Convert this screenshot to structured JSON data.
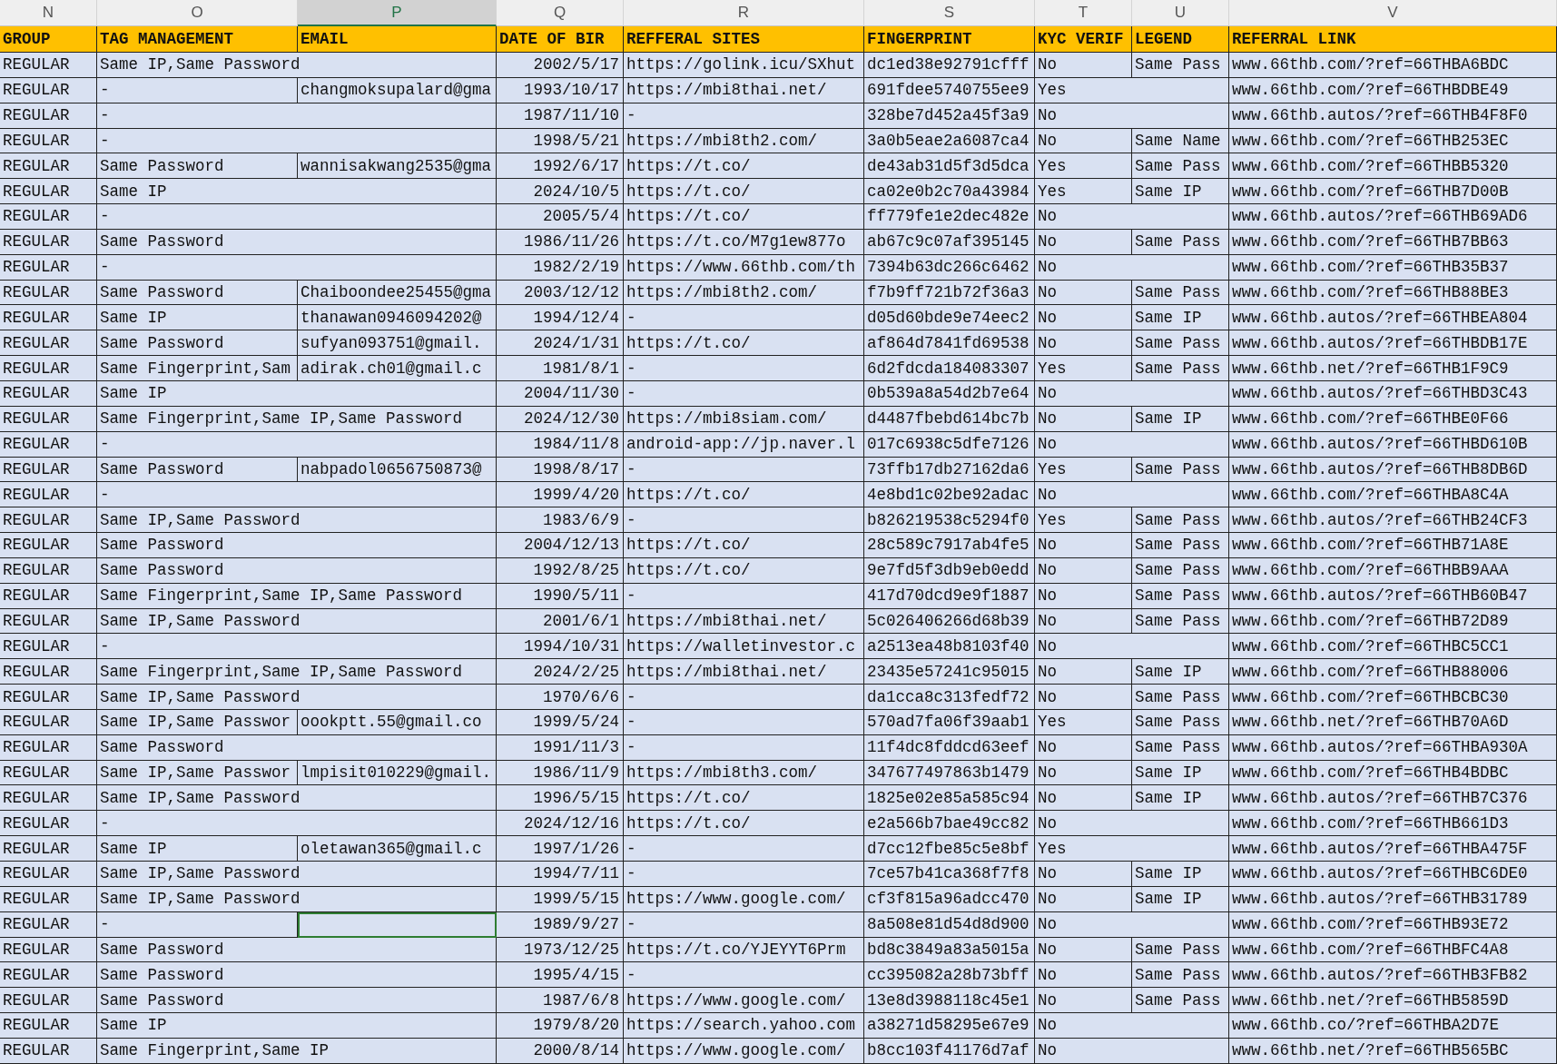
{
  "column_letters": [
    {
      "label": "N",
      "selected": false
    },
    {
      "label": "O",
      "selected": false
    },
    {
      "label": "P",
      "selected": true
    },
    {
      "label": "Q",
      "selected": false
    },
    {
      "label": "R",
      "selected": false
    },
    {
      "label": "S",
      "selected": false
    },
    {
      "label": "T",
      "selected": false
    },
    {
      "label": "U",
      "selected": false
    },
    {
      "label": "V",
      "selected": false
    }
  ],
  "header": [
    "GROUP",
    "TAG MANAGEMENT",
    "EMAIL",
    "DATE OF BIR",
    "REFFERAL SITES",
    "FINGERPRINT",
    "KYC VERIF",
    "LEGEND",
    "REFERRAL LINK"
  ],
  "rows": [
    {
      "group": "REGULAR",
      "tag": "Same IP,Same Password",
      "date_of_birth": "2002/5/17",
      "referral_site": "https://golink.icu/SXhut",
      "fingerprint": "dc1ed38e92791cfff",
      "kyc": "No",
      "legend": "Same Pass",
      "referral_link": "www.66thb.com/?ref=66THBA6BDC",
      "selected": false
    },
    {
      "group": "REGULAR",
      "tag": "-",
      "email": "changmoksupalard@gma",
      "date_of_birth": "1993/10/17",
      "referral_site": "https://mbi8thai.net/",
      "fingerprint": "691fdee5740755ee9",
      "kyc": "Yes",
      "referral_link": "www.66thb.com/?ref=66THBDBE49",
      "selected": false
    },
    {
      "group": "REGULAR",
      "tag": "-",
      "date_of_birth": "1987/11/10",
      "referral_site": "-",
      "fingerprint": "328be7d452a45f3a9",
      "kyc": "No",
      "referral_link": "www.66thb.autos/?ref=66THB4F8F0",
      "selected": false
    },
    {
      "group": "REGULAR",
      "tag": "-",
      "date_of_birth": "1998/5/21",
      "referral_site": "https://mbi8th2.com/",
      "fingerprint": "3a0b5eae2a6087ca4",
      "kyc": "No",
      "legend": "Same Name",
      "referral_link": "www.66thb.com/?ref=66THB253EC",
      "selected": false
    },
    {
      "group": "REGULAR",
      "tag": "Same Password",
      "email": "wannisakwang2535@gma",
      "date_of_birth": "1992/6/17",
      "referral_site": "https://t.co/",
      "fingerprint": "de43ab31d5f3d5dca",
      "kyc": "Yes",
      "legend": "Same Pass",
      "referral_link": "www.66thb.com/?ref=66THBB5320",
      "selected": false
    },
    {
      "group": "REGULAR",
      "tag": "Same IP",
      "date_of_birth": "2024/10/5",
      "referral_site": "https://t.co/",
      "fingerprint": "ca02e0b2c70a43984",
      "kyc": "Yes",
      "legend": "Same IP",
      "referral_link": "www.66thb.com/?ref=66THB7D00B",
      "selected": false
    },
    {
      "group": "REGULAR",
      "tag": "-",
      "date_of_birth": "2005/5/4",
      "referral_site": "https://t.co/",
      "fingerprint": "ff779fe1e2dec482e",
      "kyc": "No",
      "referral_link": "www.66thb.autos/?ref=66THB69AD6",
      "selected": false
    },
    {
      "group": "REGULAR",
      "tag": "Same Password",
      "date_of_birth": "1986/11/26",
      "referral_site": "https://t.co/M7g1ew877o",
      "fingerprint": "ab67c9c07af395145",
      "kyc": "No",
      "legend": "Same Pass",
      "referral_link": "www.66thb.com/?ref=66THB7BB63",
      "selected": false
    },
    {
      "group": "REGULAR",
      "tag": "-",
      "date_of_birth": "1982/2/19",
      "referral_site": "https://www.66thb.com/th",
      "fingerprint": "7394b63dc266c6462",
      "kyc": "No",
      "referral_link": "www.66thb.com/?ref=66THB35B37",
      "selected": false
    },
    {
      "group": "REGULAR",
      "tag": "Same Password",
      "email": "Chaiboondee25455@gma",
      "date_of_birth": "2003/12/12",
      "referral_site": "https://mbi8th2.com/",
      "fingerprint": "f7b9ff721b72f36a3",
      "kyc": "No",
      "legend": "Same Pass",
      "referral_link": "www.66thb.com/?ref=66THB88BE3",
      "selected": false
    },
    {
      "group": "REGULAR",
      "tag": "Same IP",
      "email": "thanawan0946094202@",
      "date_of_birth": "1994/12/4",
      "referral_site": "-",
      "fingerprint": "d05d60bde9e74eec2",
      "kyc": "No",
      "legend": "Same IP",
      "referral_link": "www.66thb.autos/?ref=66THBEA804",
      "selected": false
    },
    {
      "group": "REGULAR",
      "tag": "Same Password",
      "email": "sufyan093751@gmail.",
      "date_of_birth": "2024/1/31",
      "referral_site": "https://t.co/",
      "fingerprint": "af864d7841fd69538",
      "kyc": "No",
      "legend": "Same Pass",
      "referral_link": "www.66thb.autos/?ref=66THBDB17E",
      "selected": false
    },
    {
      "group": "REGULAR",
      "tag": "Same Fingerprint,Sam",
      "email": "adirak.ch01@gmail.c",
      "date_of_birth": "1981/8/1",
      "referral_site": "-",
      "fingerprint": "6d2fdcda184083307",
      "kyc": "Yes",
      "legend": "Same Pass",
      "referral_link": "www.66thb.net/?ref=66THB1F9C9",
      "selected": false
    },
    {
      "group": "REGULAR",
      "tag": "Same IP",
      "date_of_birth": "2004/11/30",
      "referral_site": "-",
      "fingerprint": "0b539a8a54d2b7e64",
      "kyc": "No",
      "referral_link": "www.66thb.autos/?ref=66THBD3C43",
      "selected": false
    },
    {
      "group": "REGULAR",
      "tag": "Same Fingerprint,Same IP,Same Password",
      "date_of_birth": "2024/12/30",
      "referral_site": "https://mbi8siam.com/",
      "fingerprint": "d4487fbebd614bc7b",
      "kyc": "No",
      "legend": "Same IP",
      "referral_link": "www.66thb.com/?ref=66THBE0F66",
      "selected": false
    },
    {
      "group": "REGULAR",
      "tag": "-",
      "date_of_birth": "1984/11/8",
      "referral_site": "android-app://jp.naver.l",
      "fingerprint": "017c6938c5dfe7126",
      "kyc": "No",
      "referral_link": "www.66thb.autos/?ref=66THBD610B",
      "selected": false
    },
    {
      "group": "REGULAR",
      "tag": "Same Password",
      "email": "nabpadol0656750873@",
      "date_of_birth": "1998/8/17",
      "referral_site": "-",
      "fingerprint": "73ffb17db27162da6",
      "kyc": "Yes",
      "legend": "Same Pass",
      "referral_link": "www.66thb.autos/?ref=66THB8DB6D",
      "selected": false
    },
    {
      "group": "REGULAR",
      "tag": "-",
      "date_of_birth": "1999/4/20",
      "referral_site": "https://t.co/",
      "fingerprint": "4e8bd1c02be92adac",
      "kyc": "No",
      "referral_link": "www.66thb.com/?ref=66THBA8C4A",
      "selected": false
    },
    {
      "group": "REGULAR",
      "tag": "Same IP,Same Password",
      "date_of_birth": "1983/6/9",
      "referral_site": "-",
      "fingerprint": "b826219538c5294f0",
      "kyc": "Yes",
      "legend": "Same Pass",
      "referral_link": "www.66thb.autos/?ref=66THB24CF3",
      "selected": false
    },
    {
      "group": "REGULAR",
      "tag": "Same Password",
      "date_of_birth": "2004/12/13",
      "referral_site": "https://t.co/",
      "fingerprint": "28c589c7917ab4fe5",
      "kyc": "No",
      "legend": "Same Pass",
      "referral_link": "www.66thb.com/?ref=66THB71A8E",
      "selected": false
    },
    {
      "group": "REGULAR",
      "tag": "Same Password",
      "date_of_birth": "1992/8/25",
      "referral_site": "https://t.co/",
      "fingerprint": "9e7fd5f3db9eb0edd",
      "kyc": "No",
      "legend": "Same Pass",
      "referral_link": "www.66thb.com/?ref=66THBB9AAA",
      "selected": false
    },
    {
      "group": "REGULAR",
      "tag": "Same Fingerprint,Same IP,Same Password",
      "date_of_birth": "1990/5/11",
      "referral_site": "-",
      "fingerprint": "417d70dcd9e9f1887",
      "kyc": "No",
      "legend": "Same Pass",
      "referral_link": "www.66thb.autos/?ref=66THB60B47",
      "selected": false
    },
    {
      "group": "REGULAR",
      "tag": "Same IP,Same Password",
      "date_of_birth": "2001/6/1",
      "referral_site": "https://mbi8thai.net/",
      "fingerprint": "5c026406266d68b39",
      "kyc": "No",
      "legend": "Same Pass",
      "referral_link": "www.66thb.com/?ref=66THB72D89",
      "selected": false
    },
    {
      "group": "REGULAR",
      "tag": "-",
      "date_of_birth": "1994/10/31",
      "referral_site": "https://walletinvestor.c",
      "fingerprint": "a2513ea48b8103f40",
      "kyc": "No",
      "referral_link": "www.66thb.com/?ref=66THBC5CC1",
      "selected": false
    },
    {
      "group": "REGULAR",
      "tag": "Same Fingerprint,Same IP,Same Password",
      "date_of_birth": "2024/2/25",
      "referral_site": "https://mbi8thai.net/",
      "fingerprint": "23435e57241c95015",
      "kyc": "No",
      "legend": "Same IP",
      "referral_link": "www.66thb.com/?ref=66THB88006",
      "selected": false
    },
    {
      "group": "REGULAR",
      "tag": "Same IP,Same Password",
      "date_of_birth": "1970/6/6",
      "referral_site": "-",
      "fingerprint": "da1cca8c313fedf72",
      "kyc": "No",
      "legend": "Same Pass",
      "referral_link": "www.66thb.com/?ref=66THBCBC30",
      "selected": false
    },
    {
      "group": "REGULAR",
      "tag": "Same IP,Same Passwor",
      "email": "oookptt.55@gmail.co",
      "date_of_birth": "1999/5/24",
      "referral_site": "-",
      "fingerprint": "570ad7fa06f39aab1",
      "kyc": "Yes",
      "legend": "Same Pass",
      "referral_link": "www.66thb.net/?ref=66THB70A6D",
      "selected": false
    },
    {
      "group": "REGULAR",
      "tag": "Same Password",
      "date_of_birth": "1991/11/3",
      "referral_site": "-",
      "fingerprint": "11f4dc8fddcd63eef",
      "kyc": "No",
      "legend": "Same Pass",
      "referral_link": "www.66thb.autos/?ref=66THBA930A",
      "selected": false
    },
    {
      "group": "REGULAR",
      "tag": "Same IP,Same Passwor",
      "email": "lmpisit010229@gmail.",
      "date_of_birth": "1986/11/9",
      "referral_site": "https://mbi8th3.com/",
      "fingerprint": "347677497863b1479",
      "kyc": "No",
      "legend": "Same IP",
      "referral_link": "www.66thb.com/?ref=66THB4BDBC",
      "selected": false
    },
    {
      "group": "REGULAR",
      "tag": "Same IP,Same Password",
      "date_of_birth": "1996/5/15",
      "referral_site": "https://t.co/",
      "fingerprint": "1825e02e85a585c94",
      "kyc": "No",
      "legend": "Same IP",
      "referral_link": "www.66thb.autos/?ref=66THB7C376",
      "selected": false
    },
    {
      "group": "REGULAR",
      "tag": "-",
      "date_of_birth": "2024/12/16",
      "referral_site": "https://t.co/",
      "fingerprint": "e2a566b7bae49cc82",
      "kyc": "No",
      "referral_link": "www.66thb.com/?ref=66THB661D3",
      "selected": false
    },
    {
      "group": "REGULAR",
      "tag": "Same IP",
      "email": "oletawan365@gmail.c",
      "date_of_birth": "1997/1/26",
      "referral_site": "-",
      "fingerprint": "d7cc12fbe85c5e8bf",
      "kyc": "Yes",
      "referral_link": "www.66thb.autos/?ref=66THBA475F",
      "selected": false
    },
    {
      "group": "REGULAR",
      "tag": "Same IP,Same Password",
      "date_of_birth": "1994/7/11",
      "referral_site": "-",
      "fingerprint": "7ce57b41ca368f7f8",
      "kyc": "No",
      "legend": "Same IP",
      "referral_link": "www.66thb.autos/?ref=66THBC6DE0",
      "selected": false
    },
    {
      "group": "REGULAR",
      "tag": "Same IP,Same Password",
      "date_of_birth": "1999/5/15",
      "referral_site": "https://www.google.com/",
      "fingerprint": "cf3f815a96adcc470",
      "kyc": "No",
      "legend": "Same IP",
      "referral_link": "www.66thb.autos/?ref=66THB31789",
      "selected": false
    },
    {
      "group": "REGULAR",
      "tag": "-",
      "date_of_birth": "1989/9/27",
      "referral_site": "-",
      "fingerprint": "8a508e81d54d8d900",
      "kyc": "No",
      "referral_link": "www.66thb.com/?ref=66THB93E72",
      "selected": true
    },
    {
      "group": "REGULAR",
      "tag": "Same Password",
      "date_of_birth": "1973/12/25",
      "referral_site": "https://t.co/YJEYYT6Prm",
      "fingerprint": "bd8c3849a83a5015a",
      "kyc": "No",
      "legend": "Same Pass",
      "referral_link": "www.66thb.com/?ref=66THBFC4A8",
      "selected": false
    },
    {
      "group": "REGULAR",
      "tag": "Same Password",
      "date_of_birth": "1995/4/15",
      "referral_site": "-",
      "fingerprint": "cc395082a28b73bff",
      "kyc": "No",
      "legend": "Same Pass",
      "referral_link": "www.66thb.autos/?ref=66THB3FB82",
      "selected": false
    },
    {
      "group": "REGULAR",
      "tag": "Same Password",
      "date_of_birth": "1987/6/8",
      "referral_site": "https://www.google.com/",
      "fingerprint": "13e8d3988118c45e1",
      "kyc": "No",
      "legend": "Same Pass",
      "referral_link": "www.66thb.net/?ref=66THB5859D",
      "selected": false
    },
    {
      "group": "REGULAR",
      "tag": "Same IP",
      "date_of_birth": "1979/8/20",
      "referral_site": "https://search.yahoo.com",
      "fingerprint": "a38271d58295e67e9",
      "kyc": "No",
      "referral_link": "www.66thb.co/?ref=66THBA2D7E",
      "selected": false
    },
    {
      "group": "REGULAR",
      "tag": "Same Fingerprint,Same IP",
      "date_of_birth": "2000/8/14",
      "referral_site": "https://www.google.com/",
      "fingerprint": "b8cc103f41176d7af",
      "kyc": "No",
      "referral_link": "www.66thb.net/?ref=66THB565BC",
      "selected": false
    }
  ]
}
